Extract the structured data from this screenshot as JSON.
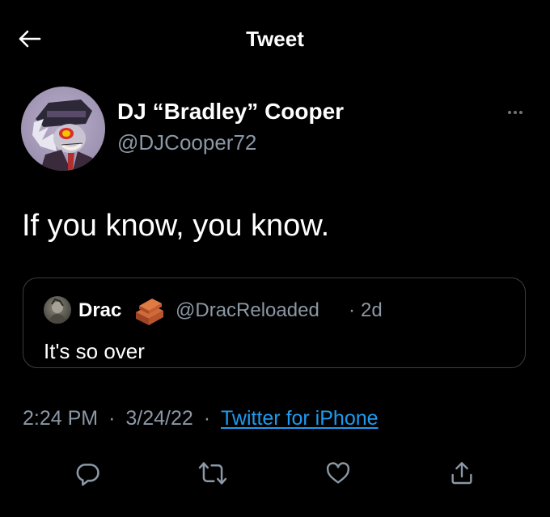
{
  "header": {
    "title": "Tweet"
  },
  "author": {
    "display_name": "DJ “Bradley” Cooper",
    "handle": "@DJCooper72"
  },
  "tweet": {
    "text": "If you know, you know."
  },
  "quote": {
    "name": "Drac",
    "handle": "@DracReloaded",
    "separator": "·",
    "time": "2d",
    "text": "It's so over"
  },
  "meta": {
    "time": "2:24 PM",
    "sep1": "·",
    "date": "3/24/22",
    "sep2": "·",
    "source": "Twitter for iPhone"
  },
  "actions": [
    {
      "icon": "reply-icon"
    },
    {
      "icon": "retweet-icon"
    },
    {
      "icon": "like-icon"
    },
    {
      "icon": "share-icon"
    }
  ],
  "colors": {
    "background": "#000000",
    "text": "#ffffff",
    "secondary_text": "#8b98a5",
    "link": "#1d9bf0",
    "border": "#3a3d41"
  }
}
